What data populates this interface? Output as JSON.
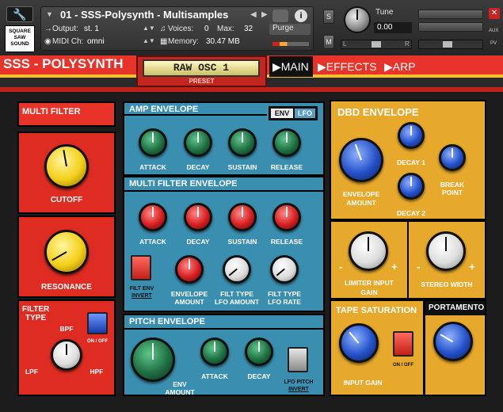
{
  "header": {
    "logo": "SQUARE SAW SOUND",
    "instrument_name": "01 - SSS-Polysynth - Multisamples",
    "output_label": "Output:",
    "output_value": "st. 1",
    "midi_label": "MIDI Ch:",
    "midi_value": "omni",
    "voices_label": "Voices:",
    "voices_value": "0",
    "max_label": "Max:",
    "max_value": "32",
    "memory_label": "Memory:",
    "memory_value": "30.47 MB",
    "purge_label": "Purge",
    "s_label": "S",
    "m_label": "M",
    "tune_label": "Tune",
    "tune_value": "0.00",
    "pan_left": "L",
    "pan_right": "R",
    "aux_label": "AUX",
    "pv_label": "PV"
  },
  "tabs": {
    "title": "SSS - POLYSYNTH",
    "preset_value": "RAW OSC 1",
    "preset_label": "PRESET",
    "main": "▶MAIN",
    "effects": "▶EFFECTS",
    "arp": "▶ARP"
  },
  "multi_filter": {
    "title": "MULTI FILTER",
    "cutoff": "CUTOFF",
    "resonance": "RESONANCE",
    "filter_type_1": "FILTER",
    "filter_type_2": "TYPE",
    "bpf": "BPF",
    "lpf": "LPF",
    "hpf": "HPF",
    "onoff": "ON / OFF"
  },
  "amp_env": {
    "title": "AMP ENVELOPE",
    "env": "ENV",
    "lfo": "LFO",
    "attack": "ATTACK",
    "decay": "DECAY",
    "sustain": "SUSTAIN",
    "release": "RELEASE"
  },
  "filter_env": {
    "title": "MULTI FILTER ENVELOPE",
    "attack": "ATTACK",
    "decay": "DECAY",
    "sustain": "SUSTAIN",
    "release": "RELEASE",
    "invert_1": "FILT ENV",
    "invert_2": "INVERT",
    "env_amount_1": "ENVELOPE",
    "env_amount_2": "AMOUNT",
    "lfo_amount_1": "FILT TYPE",
    "lfo_amount_2": "LFO AMOUNT",
    "lfo_rate_1": "FILT TYPE",
    "lfo_rate_2": "LFO RATE"
  },
  "pitch_env": {
    "title": "PITCH ENVELOPE",
    "env_amount_1": "ENV",
    "env_amount_2": "AMOUNT",
    "attack": "ATTACK",
    "decay": "DECAY",
    "invert_1": "LFO PITCH",
    "invert_2": "INVERT"
  },
  "dbd_env": {
    "title": "DBD ENVELOPE",
    "decay1": "DECAY 1",
    "decay2": "DECAY 2",
    "env_amount_1": "ENVELOPE",
    "env_amount_2": "AMOUNT",
    "break_point_1": "BREAK",
    "break_point_2": "POINT"
  },
  "limiter": {
    "label_1": "LIMITER INPUT",
    "label_2": "GAIN",
    "minus": "-",
    "plus": "+"
  },
  "stereo": {
    "label": "STEREO WIDTH",
    "minus": "-",
    "plus": "+"
  },
  "tape": {
    "title": "TAPE SATURATION",
    "input_gain": "INPUT GAIN",
    "onoff": "ON / OFF"
  },
  "portamento": {
    "title": "PORTAMENTO"
  },
  "colors": {
    "red": "#df2c22",
    "blue": "#3a8fb0",
    "yellow": "#e7a92b"
  }
}
